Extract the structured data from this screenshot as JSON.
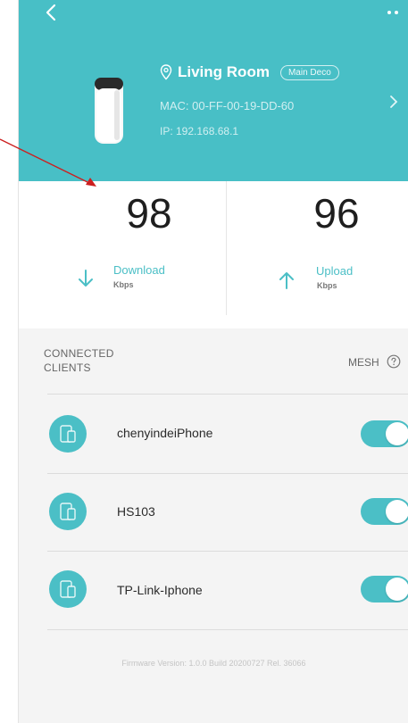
{
  "device": {
    "name": "Living Room",
    "main_badge": "Main Deco",
    "mac": "MAC: 00-FF-00-19-DD-60",
    "ip": "IP: 192.168.68.1"
  },
  "stats": {
    "download": {
      "value": "98",
      "label": "Download",
      "unit": "Kbps"
    },
    "upload": {
      "value": "96",
      "label": "Upload",
      "unit": "Kbps"
    }
  },
  "clients_section": {
    "title_line1": "CONNECTED",
    "title_line2": "CLIENTS",
    "mesh_label": "MESH"
  },
  "clients": [
    {
      "name": "chenyindeiPhone",
      "mesh_on": true
    },
    {
      "name": "HS103",
      "mesh_on": true
    },
    {
      "name": "TP-Link-Iphone",
      "mesh_on": true
    }
  ],
  "firmware": "Firmware Version: 1.0.0 Build 20200727 Rel. 36066",
  "colors": {
    "accent": "#48bfc6",
    "annotation_arrow": "#cc1f1f"
  }
}
